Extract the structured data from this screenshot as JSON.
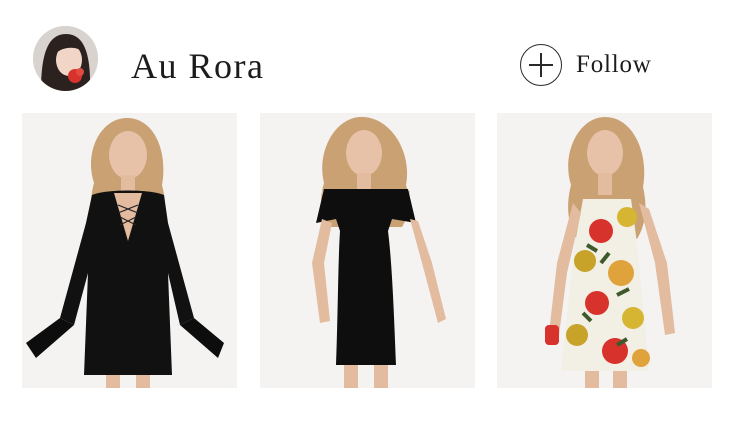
{
  "profile": {
    "username": "Au Rora",
    "avatar_icon": "user-avatar-photo"
  },
  "follow": {
    "label": "Follow",
    "icon": "plus-circle-icon"
  },
  "products": [
    {
      "item": "black-bell-sleeve-dress-photo",
      "dress_color": "#111111"
    },
    {
      "item": "black-bardot-dress-photo",
      "dress_color": "#0e0e0e"
    },
    {
      "item": "floral-print-dress-photo",
      "dress_color": "#f2efe4"
    }
  ],
  "colors": {
    "background": "#ffffff",
    "text": "#1c1c1c",
    "card_background": "#f4f3f2",
    "hair": "#c9a173",
    "skin": "#e8c2a8"
  }
}
